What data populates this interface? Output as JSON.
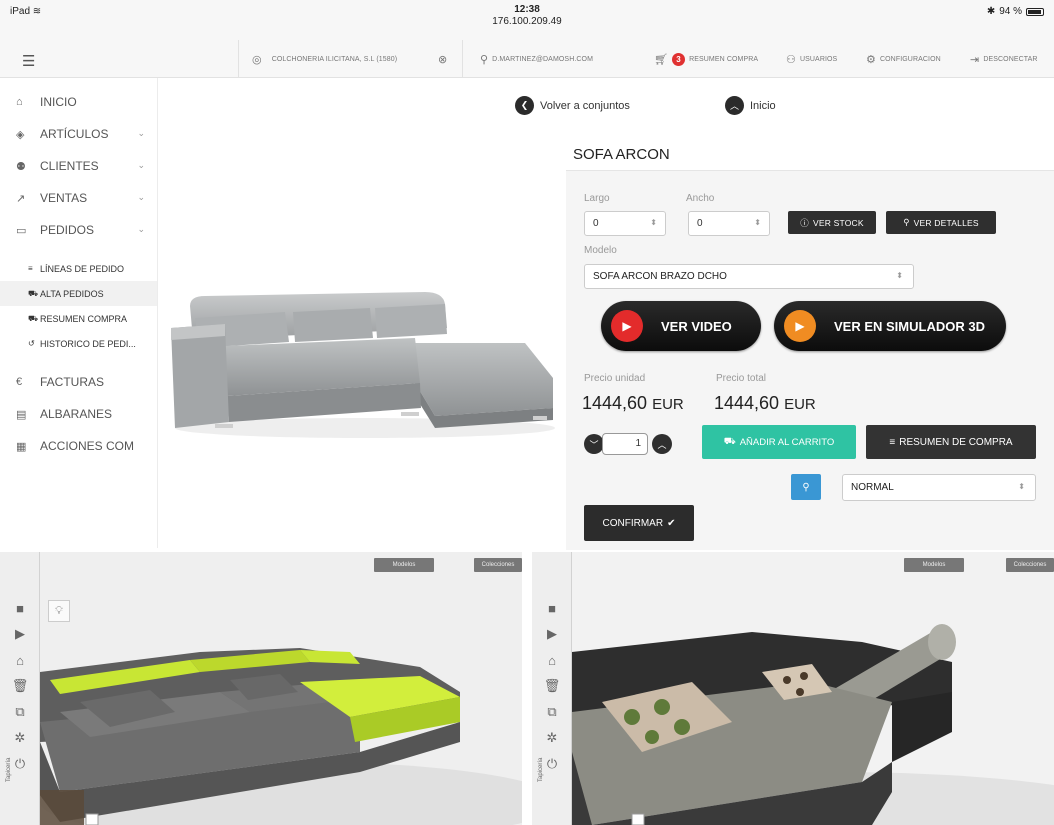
{
  "status_bar": {
    "device": "iPad",
    "time": "12:38",
    "ip": "176.100.209.49",
    "battery": "94 %"
  },
  "topbar": {
    "company": "COLCHONERIA ILICITANA, S.L (1580)",
    "user": "D.MARTINEZ@DAMOSH.COM",
    "cart_count": "3",
    "cart_label": "RESUMEN COMPRA",
    "users_label": "USUARIOS",
    "settings_label": "CONFIGURACION",
    "logout_label": "DESCONECTAR"
  },
  "sidebar": {
    "items": [
      {
        "label": "INICIO"
      },
      {
        "label": "ARTÍCULOS"
      },
      {
        "label": "CLIENTES"
      },
      {
        "label": "VENTAS"
      },
      {
        "label": "PEDIDOS"
      }
    ],
    "subitems": [
      {
        "label": "LÍNEAS DE PEDIDO"
      },
      {
        "label": "ALTA PEDIDOS"
      },
      {
        "label": "RESUMEN COMPRA"
      },
      {
        "label": "HISTORICO DE PEDI..."
      }
    ],
    "items_bottom": [
      {
        "label": "FACTURAS"
      },
      {
        "label": "ALBARANES"
      },
      {
        "label": "ACCIONES COM"
      }
    ]
  },
  "nav": {
    "back_label": "Volver a conjuntos",
    "home_label": "Inicio"
  },
  "product": {
    "title": "SOFA ARCON",
    "largo_label": "Largo",
    "largo_value": "0",
    "ancho_label": "Ancho",
    "ancho_value": "0",
    "stock_button": "VER STOCK",
    "details_button": "VER DETALLES",
    "model_label": "Modelo",
    "model_value": "SOFA ARCON BRAZO DCHO",
    "video_button": "VER VIDEO",
    "simulator_button": "VER EN SIMULADOR 3D",
    "unit_price_label": "Precio unidad",
    "total_price_label": "Precio total",
    "unit_price": "1444,60",
    "total_price": "1444,60",
    "currency": "EUR",
    "quantity": "1",
    "add_cart_button": "AÑADIR AL CARRITO",
    "summary_button": "RESUMEN DE COMPRA",
    "shipping_value": "NORMAL",
    "confirm_button": "CONFIRMAR"
  },
  "simulator": {
    "btn_models": "Modelos",
    "btn_collections": "Colecciones",
    "side_label": "Tapicería"
  },
  "colors": {
    "accent_teal": "#2fc3a3",
    "search_blue": "#3a97d4",
    "badge_red": "#e03131",
    "video_red": "#e32b2b",
    "sim_orange": "#f08c22",
    "lime_fabric": "#c8e634"
  }
}
